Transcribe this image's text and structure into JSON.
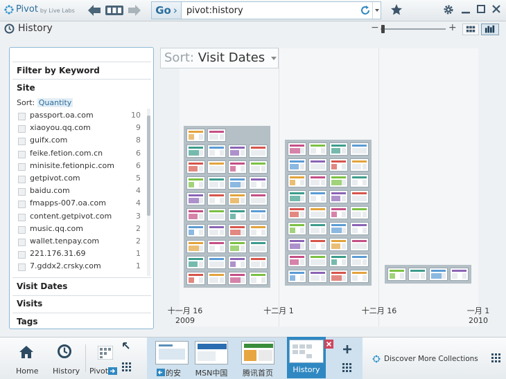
{
  "app": {
    "brand": "Pivot",
    "brand_sub": "by Live Labs",
    "go_label": "Go",
    "go_chevron": "›",
    "address_value": "pivot:history"
  },
  "page": {
    "title": "History"
  },
  "filter_panel": {
    "keyword_header": "Filter by Keyword",
    "site_header": "Site",
    "sort_prefix": "Sort:",
    "sort_value": "Quantity",
    "sites": [
      {
        "name": "passport.oa.com",
        "qty": "10"
      },
      {
        "name": "xiaoyou.qq.com",
        "qty": "9"
      },
      {
        "name": "guifx.com",
        "qty": "8"
      },
      {
        "name": "feike.fetion.com.cn",
        "qty": "6"
      },
      {
        "name": "minisite.fetionpic.com",
        "qty": "6"
      },
      {
        "name": "getpivot.com",
        "qty": "5"
      },
      {
        "name": "baidu.com",
        "qty": "4"
      },
      {
        "name": "fmapps-007.oa.com",
        "qty": "4"
      },
      {
        "name": "content.getpivot.com",
        "qty": "3"
      },
      {
        "name": "music.qq.com",
        "qty": "2"
      },
      {
        "name": "wallet.tenpay.com",
        "qty": "2"
      },
      {
        "name": "221.176.31.69",
        "qty": "1"
      },
      {
        "name": "7.gddx2.crsky.com",
        "qty": "1"
      }
    ],
    "visit_dates_header": "Visit Dates",
    "visits_header": "Visits",
    "tags_header": "Tags"
  },
  "graph": {
    "sort_key": "Sort:",
    "sort_value": "Visit Dates",
    "x_labels": [
      {
        "line1": "十一月 16",
        "line2": "2009"
      },
      {
        "line1": "十二月 1",
        "line2": ""
      },
      {
        "line1": "十二月 16",
        "line2": ""
      },
      {
        "line1": "一月 1",
        "line2": "2010"
      }
    ],
    "bins": [
      {
        "count": 38,
        "cols": 4
      },
      {
        "count": 36,
        "cols": 4
      },
      {
        "count": 4,
        "cols": 4
      }
    ]
  },
  "bottom_bar": {
    "home_label": "Home",
    "history_label": "History",
    "pivot_label": "Pivot",
    "tabs": [
      {
        "label": "的安"
      },
      {
        "label": "MSN中国"
      },
      {
        "label": "腾讯首页"
      },
      {
        "label": "History"
      }
    ],
    "add_tab_label": "+",
    "discover_label": "Discover More Collections"
  },
  "colors": {
    "accent": "#2f88c2",
    "brand": "#2a6d9c",
    "panel_border": "#8cb9d6"
  }
}
